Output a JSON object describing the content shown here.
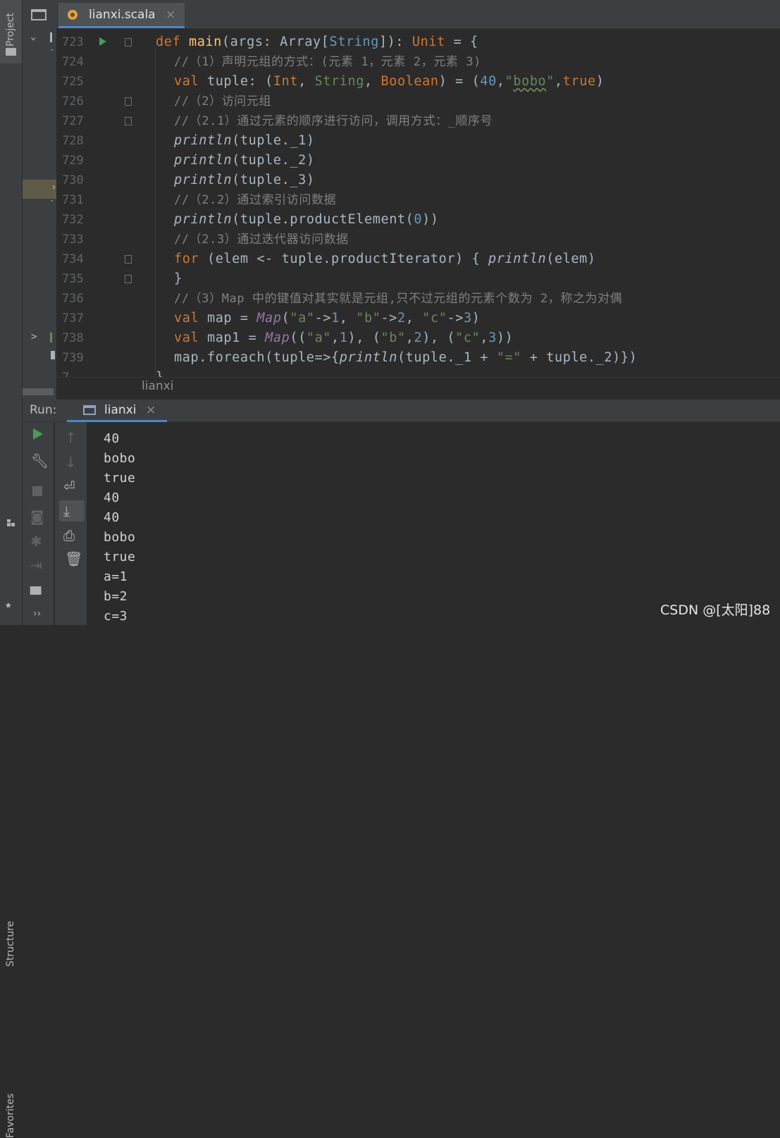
{
  "sidebar": {
    "project_label": "Project",
    "structure_label": "Structure",
    "favorites_label": "Favorites"
  },
  "editor": {
    "tab_label": "lianxi.scala",
    "tab_close": "×",
    "breadcrumb": "lianxi",
    "lines": [
      {
        "no": "723"
      },
      {
        "no": "724"
      },
      {
        "no": "725"
      },
      {
        "no": "726"
      },
      {
        "no": "727"
      },
      {
        "no": "728"
      },
      {
        "no": "729"
      },
      {
        "no": "730"
      },
      {
        "no": "731"
      },
      {
        "no": "732"
      },
      {
        "no": "733"
      },
      {
        "no": "734"
      },
      {
        "no": "735"
      },
      {
        "no": "736"
      },
      {
        "no": "737"
      },
      {
        "no": "738"
      },
      {
        "no": "739"
      }
    ]
  },
  "run": {
    "label": "Run:",
    "tab_label": "lianxi",
    "tab_close": "×",
    "output": [
      "40",
      "bobo",
      "true",
      "40",
      "40",
      "bobo",
      "true",
      "a=1",
      "b=2",
      "c=3"
    ]
  },
  "watermark": "CSDN @[太阳]88",
  "colors": {
    "keyword": "#cc7832",
    "function": "#ffc66d",
    "type": "#6897bb",
    "string": "#6a8759",
    "comment": "#808080",
    "accent": "#4a88c7"
  }
}
